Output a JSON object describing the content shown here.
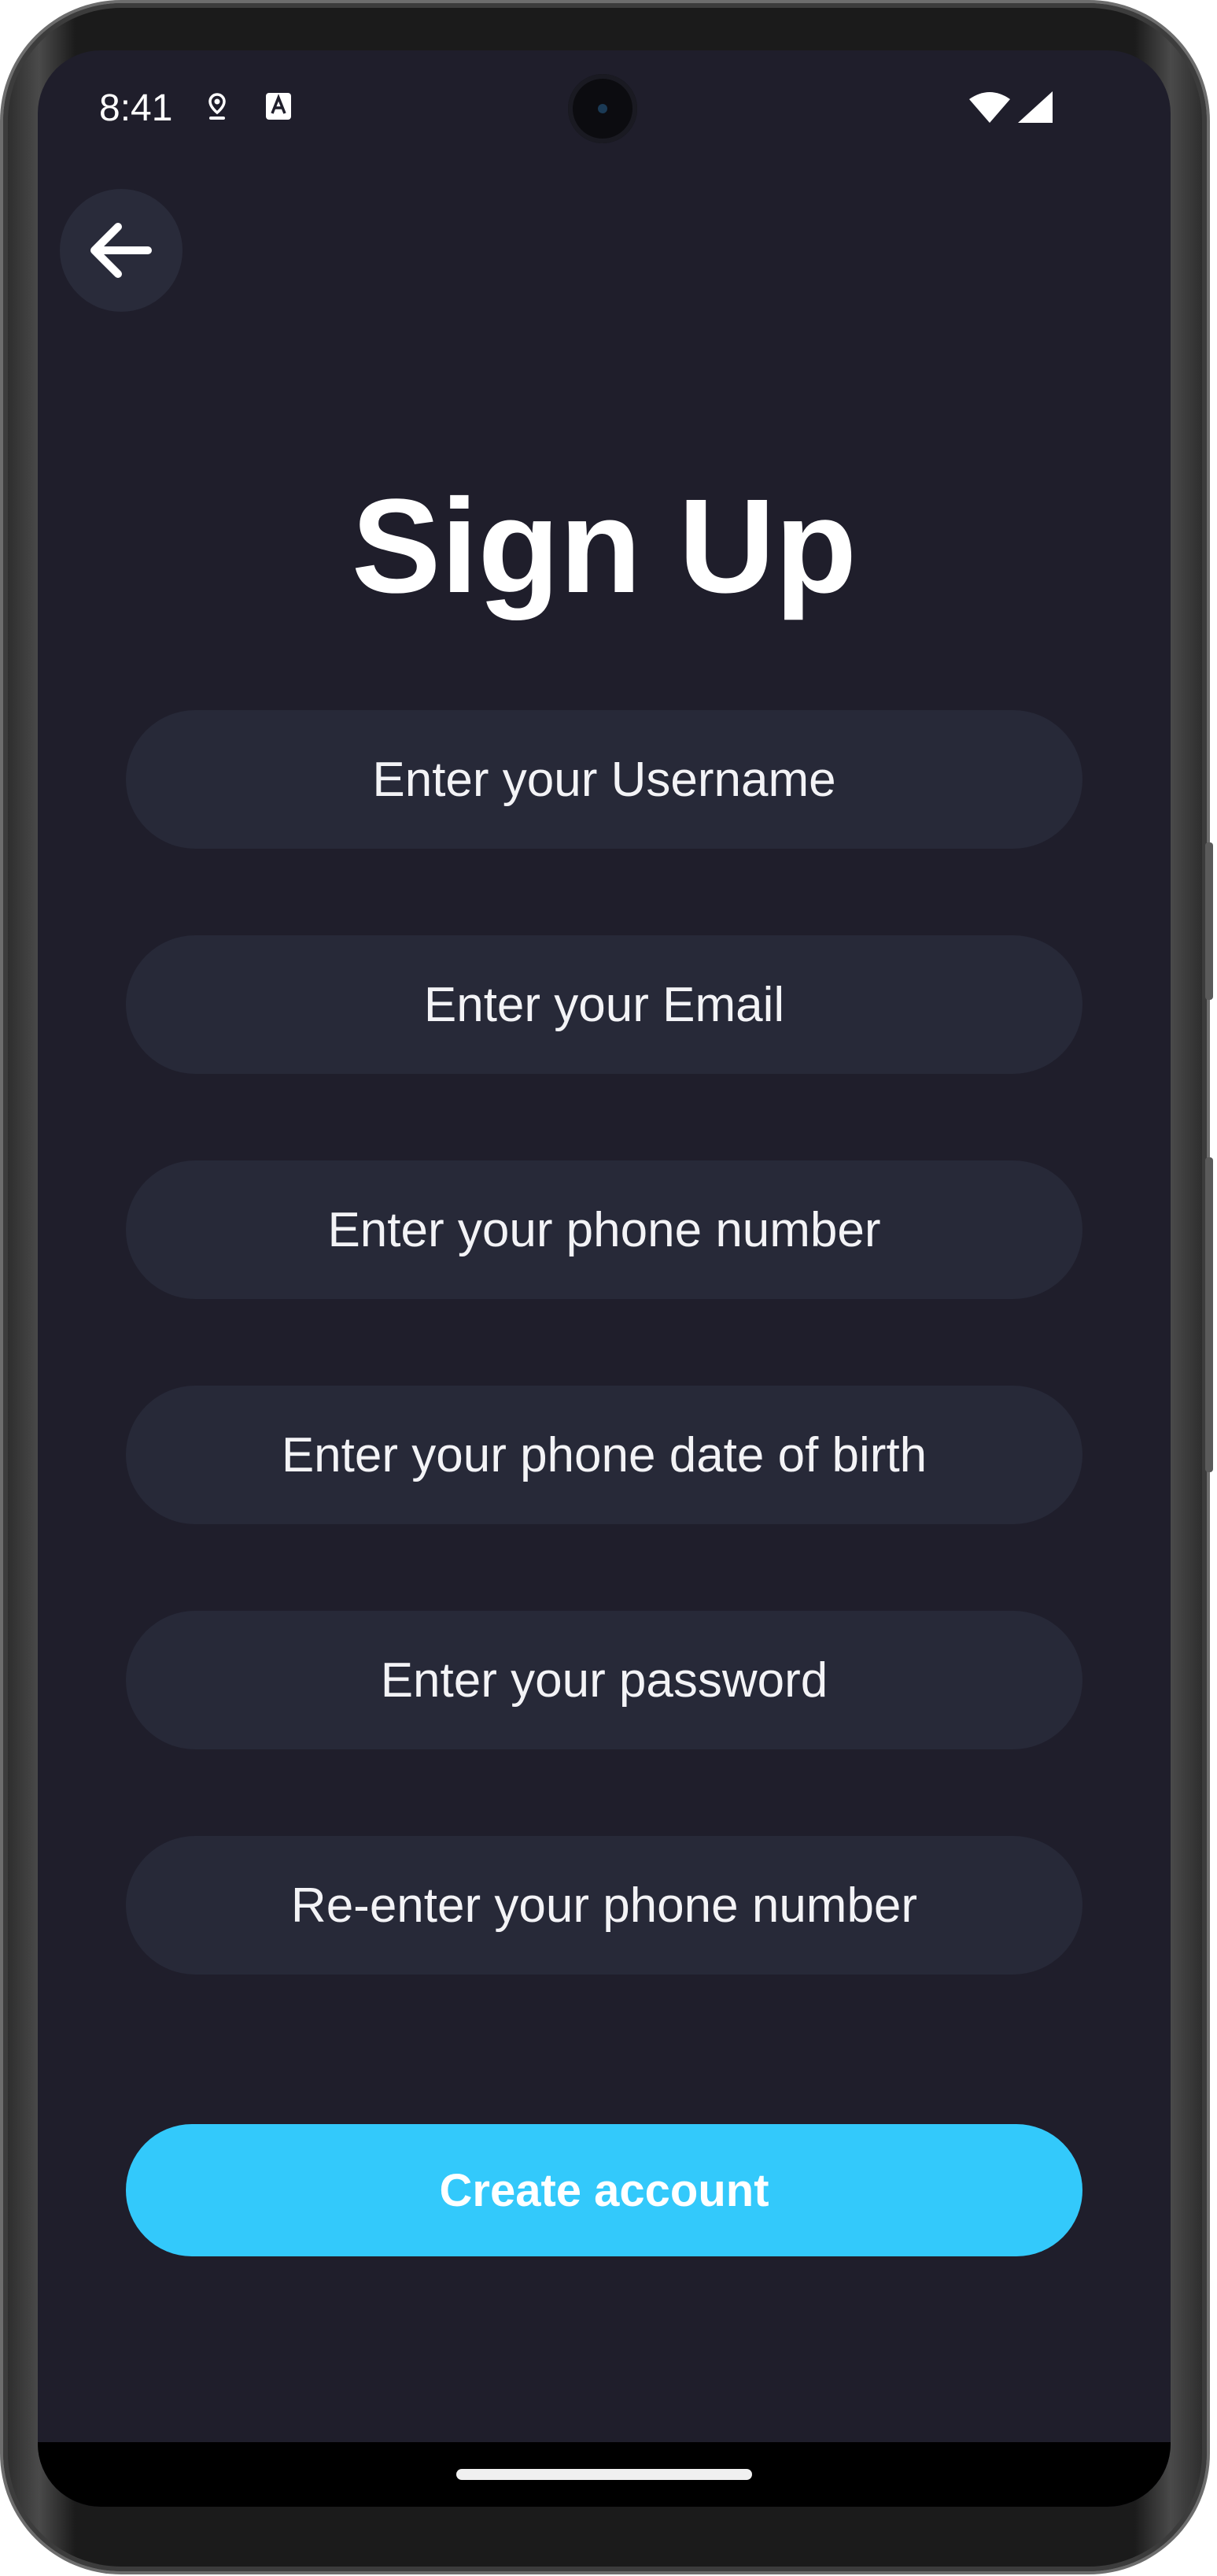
{
  "status_bar": {
    "time": "8:41",
    "icons": [
      "pin-icon",
      "a-keyboard-icon",
      "wifi-icon",
      "signal-icon"
    ]
  },
  "nav": {
    "back_icon": "arrow-left-icon"
  },
  "page": {
    "title": "Sign Up"
  },
  "form": {
    "fields": [
      {
        "name": "username",
        "placeholder": "Enter your Username"
      },
      {
        "name": "email",
        "placeholder": "Enter your Email"
      },
      {
        "name": "phone",
        "placeholder": "Enter your phone number"
      },
      {
        "name": "dob",
        "placeholder": "Enter your phone date of birth"
      },
      {
        "name": "password",
        "placeholder": "Enter your password"
      },
      {
        "name": "reenter",
        "placeholder": "Re-enter your phone number"
      }
    ],
    "submit_label": "Create account"
  },
  "colors": {
    "background": "#1f1e2b",
    "field_background": "#272938",
    "accent": "#33c9fb",
    "text": "#ffffff"
  }
}
